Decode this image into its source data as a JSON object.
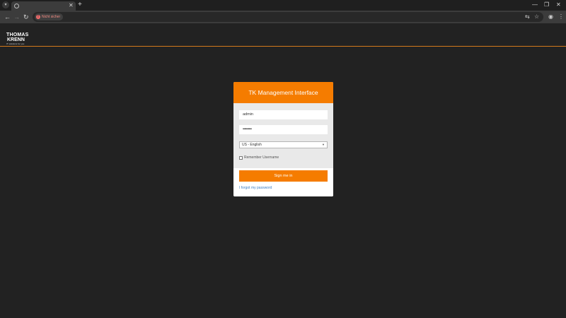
{
  "browser": {
    "tab_menu_icon": "chevron-down-icon",
    "tab_favicon_icon": "globe-icon",
    "tab_close_glyph": "✕",
    "new_tab_glyph": "+",
    "minimize_glyph": "—",
    "restore_glyph": "❐",
    "close_glyph": "✕",
    "back_glyph": "←",
    "forward_glyph": "→",
    "reload_glyph": "↻",
    "security_label": "Nicht sicher",
    "translate_glyph": "⇆",
    "bookmark_glyph": "☆",
    "profile_glyph": "◉",
    "menu_glyph": "⋮"
  },
  "site": {
    "logo_line1": "THOMAS",
    "logo_line2": "KRENN",
    "logo_tagline": "IT solutions for you"
  },
  "login": {
    "title": "TK Management Interface",
    "username_value": "admin",
    "password_value": "••••••••••",
    "language_selected": "US - English",
    "remember_label": "Remember Username",
    "signin_label": "Sign me in",
    "forgot_label": "I forgot my password"
  },
  "colors": {
    "accent": "#f57c00",
    "page_bg": "#222222",
    "link": "#3b7dc4"
  }
}
